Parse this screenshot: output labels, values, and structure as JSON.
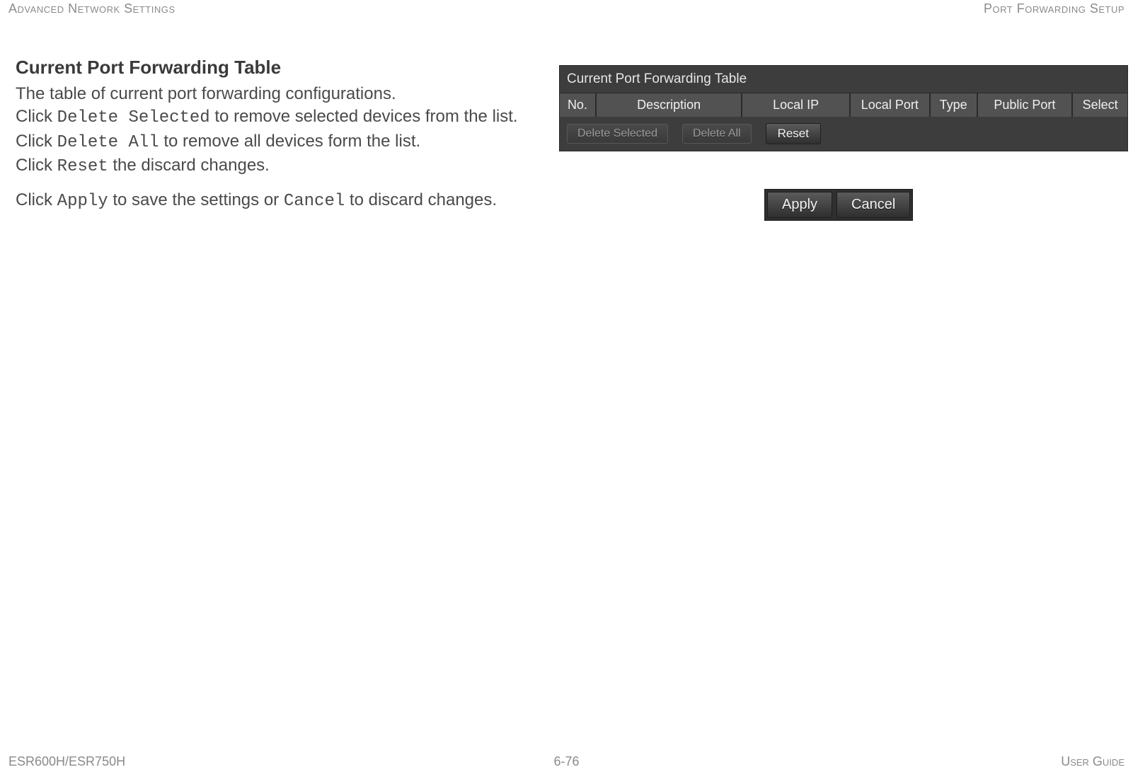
{
  "header": {
    "left": "Advanced Network Settings",
    "right": "Port Forwarding Setup"
  },
  "section": {
    "title": "Current Port Forwarding Table",
    "intro": "The table of current port forwarding configurations.",
    "line_ds_pre": "Click ",
    "code_ds": "Delete Selected",
    "line_ds_post": " to remove selected devices from the list.",
    "line_da_pre": "Click ",
    "code_da": "Delete All",
    "line_da_post": " to remove all devices form the list.",
    "line_rs_pre": "Click ",
    "code_rs": "Reset",
    "line_rs_post": " the discard changes.",
    "line_ac_pre": "Click ",
    "code_apply": "Apply",
    "line_ac_mid": " to save the settings or ",
    "code_cancel": "Cancel",
    "line_ac_post": " to discard changes."
  },
  "ui": {
    "panel_title": "Current Port Forwarding Table",
    "columns": {
      "no": "No.",
      "desc": "Description",
      "lip": "Local IP",
      "lport": "Local Port",
      "type": "Type",
      "pport": "Public Port",
      "select": "Select"
    },
    "buttons": {
      "delete_selected": "Delete Selected",
      "delete_all": "Delete All",
      "reset": "Reset",
      "apply": "Apply",
      "cancel": "Cancel"
    }
  },
  "footer": {
    "left": "ESR600H/ESR750H",
    "center": "6-76",
    "right": "User Guide"
  }
}
